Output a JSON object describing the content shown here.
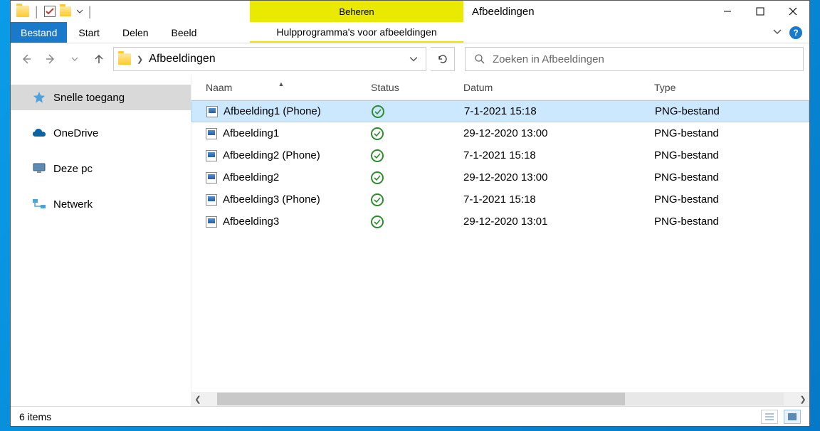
{
  "window": {
    "title": "Afbeeldingen",
    "manage_label": "Beheren"
  },
  "ribbon": {
    "file": "Bestand",
    "tabs": [
      "Start",
      "Delen",
      "Beeld"
    ],
    "context_tab": "Hulpprogramma's voor afbeeldingen"
  },
  "nav": {
    "breadcrumb": "Afbeeldingen",
    "search_placeholder": "Zoeken in Afbeeldingen"
  },
  "sidebar": {
    "items": [
      {
        "label": "Snelle toegang",
        "icon": "star-pin",
        "selected": true
      },
      {
        "label": "OneDrive",
        "icon": "cloud"
      },
      {
        "label": "Deze pc",
        "icon": "pc"
      },
      {
        "label": "Netwerk",
        "icon": "network"
      }
    ]
  },
  "columns": {
    "name": "Naam",
    "status": "Status",
    "date": "Datum",
    "type": "Type",
    "sort": "asc"
  },
  "files": [
    {
      "name": "Afbeelding1 (Phone)",
      "date": "7-1-2021 15:18",
      "type": "PNG-bestand",
      "status": "ok",
      "selected": true
    },
    {
      "name": "Afbeelding1",
      "date": "29-12-2020 13:00",
      "type": "PNG-bestand",
      "status": "ok"
    },
    {
      "name": "Afbeelding2 (Phone)",
      "date": "7-1-2021 15:18",
      "type": "PNG-bestand",
      "status": "ok"
    },
    {
      "name": "Afbeelding2",
      "date": "29-12-2020 13:00",
      "type": "PNG-bestand",
      "status": "ok"
    },
    {
      "name": "Afbeelding3 (Phone)",
      "date": "7-1-2021 15:18",
      "type": "PNG-bestand",
      "status": "ok"
    },
    {
      "name": "Afbeelding3",
      "date": "29-12-2020 13:01",
      "type": "PNG-bestand",
      "status": "ok"
    }
  ],
  "statusbar": {
    "items_text": "6 items"
  }
}
